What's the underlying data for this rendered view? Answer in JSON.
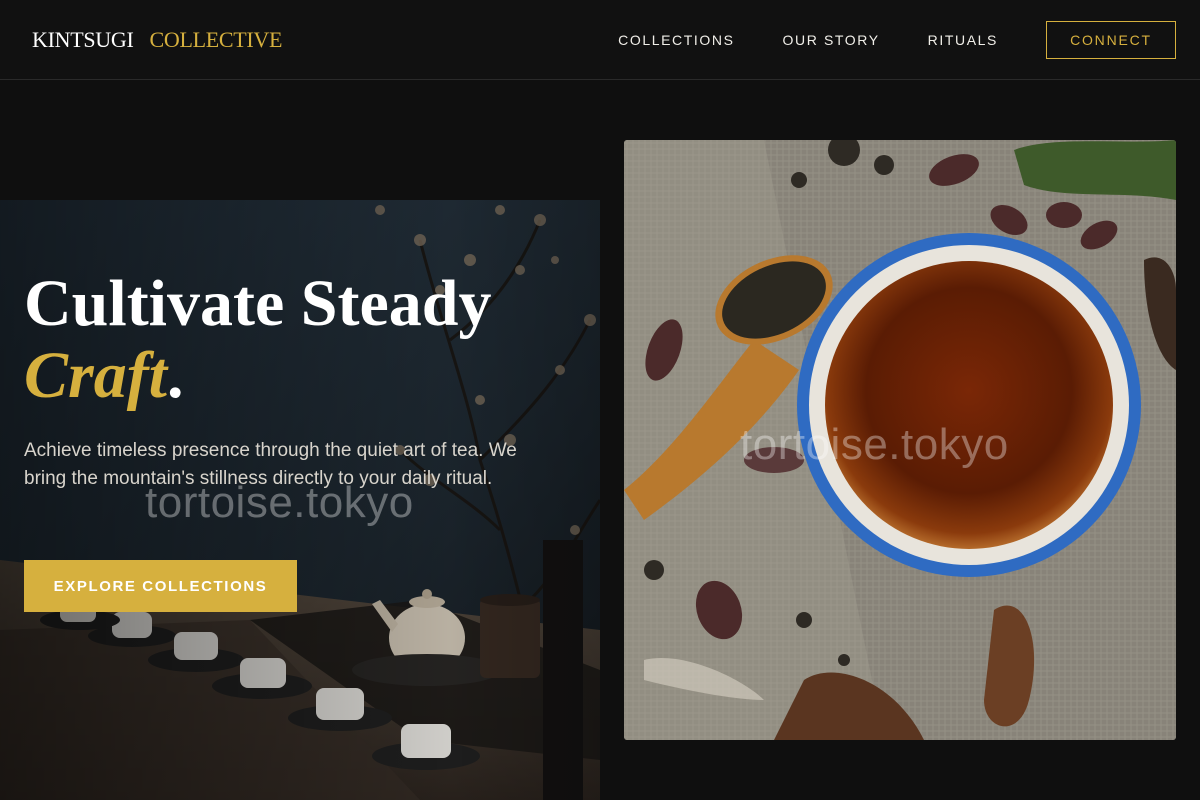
{
  "brand": {
    "part1": "KINTSUGI",
    "part2": "COLLECTIVE"
  },
  "nav": {
    "items": [
      {
        "label": "COLLECTIONS"
      },
      {
        "label": "OUR STORY"
      },
      {
        "label": "RITUALS"
      }
    ],
    "connect_label": "CONNECT"
  },
  "hero": {
    "title_line1": "Cultivate Steady",
    "title_accent": "Craft",
    "title_punct": ".",
    "description": "Achieve timeless presence through the quiet art of tea. We bring the mountain's stillness directly to your daily ritual.",
    "cta_label": "EXPLORE COLLECTIONS"
  },
  "watermark": "tortoise.tokyo",
  "colors": {
    "accent": "#d6b03e",
    "background": "#0f0f0f",
    "header": "#111111"
  }
}
